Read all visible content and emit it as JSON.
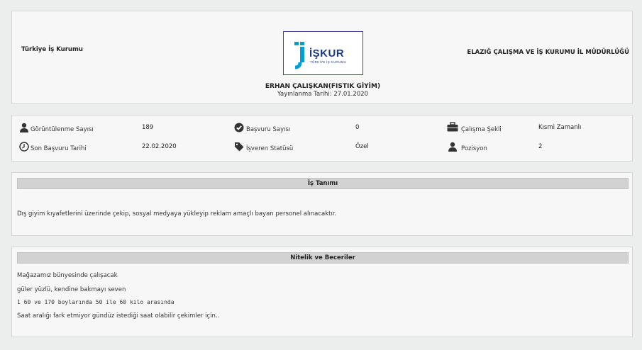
{
  "header": {
    "org_left": "Türkiye İş Kurumu",
    "org_right": "ELAZIĞ ÇALIŞMA VE İŞ KURUMU İL MÜDÜRLÜĞÜ",
    "logo_text": "İŞKUR",
    "logo_subtext": "TÜRKİYE İŞ KURUMU",
    "employer": "ERHAN ÇALIŞKAN(FISTIK GİYİM)",
    "publish_date": "Yayınlanma Tarihi: 27.01.2020"
  },
  "stats": {
    "views_label": "Görüntülenme Sayısı",
    "views_value": "189",
    "applications_label": "Başvuru Sayısı",
    "applications_value": "0",
    "work_type_label": "Çalışma Şekli",
    "work_type_value": "Kısmi Zamanlı",
    "deadline_label": "Son Başvuru Tarihi",
    "deadline_value": "22.02.2020",
    "employer_status_label": "İşveren Statüsü",
    "employer_status_value": "Özel",
    "positions_label": "Pozisyon",
    "positions_value": "2"
  },
  "description": {
    "title": "İş Tanımı",
    "text": "Dış giyim kıyafetlerini üzerinde çekip, sosyal medyaya yükleyip reklam amaçlı bayan personel alınacaktır."
  },
  "skills": {
    "title": "Nitelik ve Beceriler",
    "lines": [
      "Mağazamız bünyesinde çalışacak",
      "güler yüzlü, kendine bakmayı seven",
      "1 60 ve 170 boylarında 50 ile 60 kilo arasında",
      "Saat aralığı fark etmiyor gündüz istediği saat olabilir çekimler için.."
    ]
  },
  "colors": {
    "brand_blue": "#1d3b82",
    "accent_cyan": "#00a0d6",
    "panel_bg": "#f7f7f7",
    "section_bar": "#d2d2d2"
  }
}
